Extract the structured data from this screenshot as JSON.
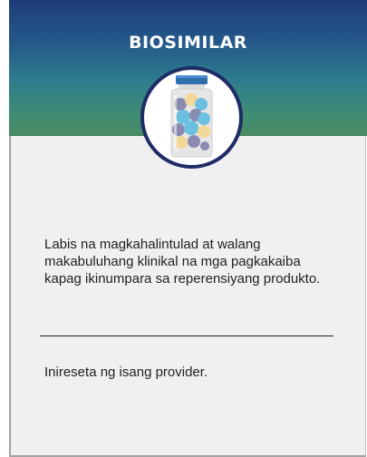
{
  "card": {
    "title": "BIOSIMILAR",
    "icon": "pill-bottle-icon",
    "description": "Labis na magkahalintulad at walang makabuluhang klinikal na mga pagkakaiba kapag ikinumpara sa reperensiyang produkto.",
    "note": "Inireseta ng isang provider."
  },
  "colors": {
    "header_top": "#1e3c7a",
    "header_bottom": "#4a8a62",
    "badge_border": "#1e2b66",
    "card_background": "#f0f0f0",
    "pill_purple": "#8a8bb0",
    "pill_blue": "#6bbfe0",
    "pill_yellow": "#f2d898"
  }
}
